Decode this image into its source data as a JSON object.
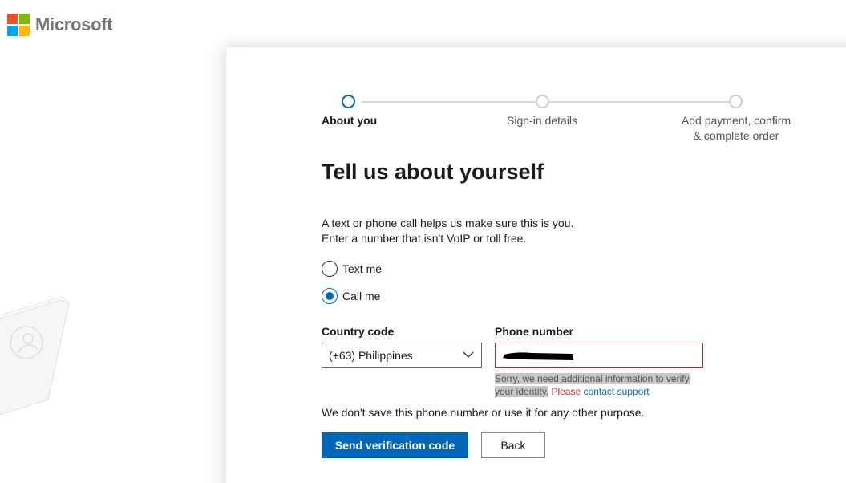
{
  "brand": {
    "name": "Microsoft",
    "colors": {
      "red": "#f25022",
      "green": "#7fba00",
      "blue": "#00a4ef",
      "yellow": "#ffb900"
    }
  },
  "stepper": {
    "steps": [
      {
        "label": "About you",
        "state": "active"
      },
      {
        "label": "Sign-in details",
        "state": "upcoming"
      },
      {
        "label_line1": "Add payment, confirm",
        "label_line2": "& complete order",
        "state": "upcoming"
      }
    ]
  },
  "form": {
    "title": "Tell us about yourself",
    "description_line1": "A text or phone call helps us make sure this is you.",
    "description_line2": "Enter a number that isn't VoIP or toll free.",
    "options": [
      {
        "label": "Text me",
        "checked": false
      },
      {
        "label": "Call me",
        "checked": true
      }
    ],
    "country_code": {
      "label": "Country code",
      "value": "(+63) Philippines"
    },
    "phone_number": {
      "label": "Phone number",
      "value": ""
    },
    "error": {
      "text": "Sorry, we need additional information to verify your identity.",
      "action": "Please",
      "link": "contact support"
    },
    "privacy_note": "We don't save this phone number or use it for any other purpose.",
    "buttons": {
      "primary": "Send verification code",
      "secondary": "Back"
    }
  },
  "colors": {
    "accent": "#0067b8",
    "error": "#c4262e"
  }
}
